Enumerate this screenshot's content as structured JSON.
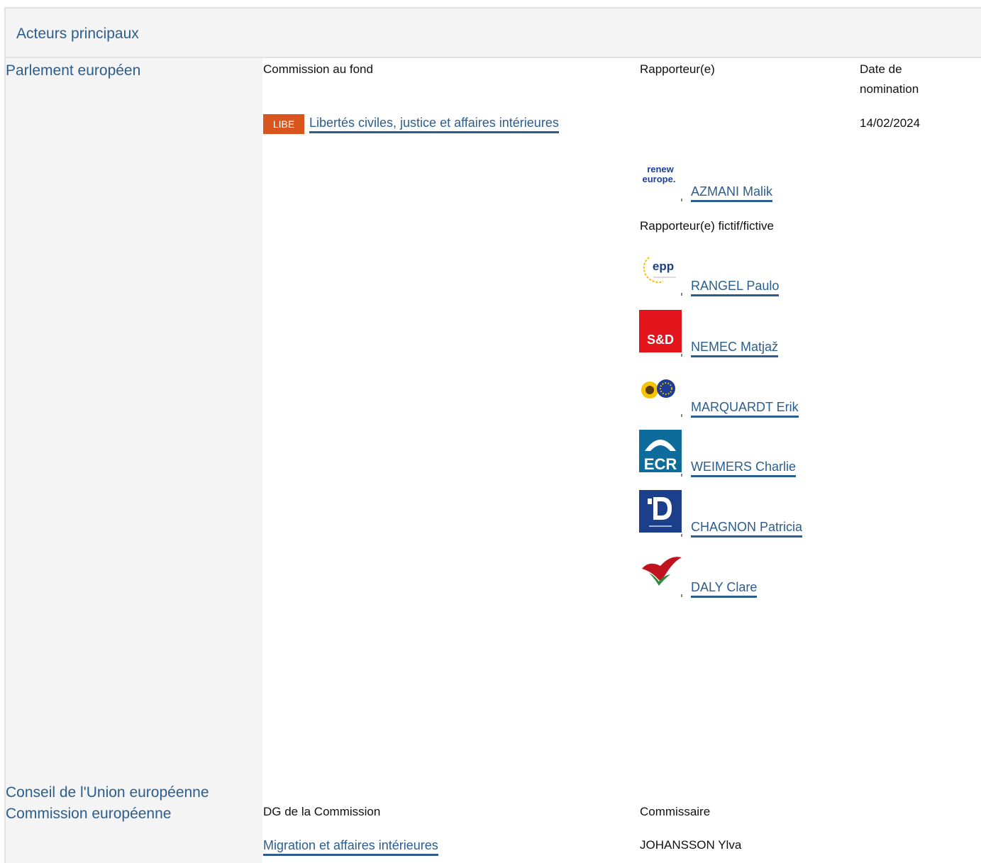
{
  "section": {
    "title": "Acteurs principaux"
  },
  "parliament": {
    "institution": "Parlement européen",
    "col_committee": "Commission au fond",
    "col_rapporteur": "Rapporteur(e)",
    "col_date": "Date de nomination",
    "committee_code": "LIBE",
    "committee_name": "Libertés civiles, justice et affaires intérieures",
    "date": "14/02/2024",
    "rapporteur": {
      "group": "Renew Europe",
      "logo_text_1": "renew",
      "logo_text_2": "europe.",
      "name": "AZMANI Malik"
    },
    "shadow_label": "Rapporteur(e) fictif/fictive",
    "shadows": [
      {
        "group": "EPP",
        "logo_text": "epp",
        "name": "RANGEL Paulo"
      },
      {
        "group": "S&D",
        "logo_text": "S&D",
        "name": "NEMEC Matjaž"
      },
      {
        "group": "Greens/EFA",
        "name": "MARQUARDT Erik"
      },
      {
        "group": "ECR",
        "logo_text": "ECR",
        "name": "WEIMERS Charlie"
      },
      {
        "group": "ID",
        "name": "CHAGNON Patricia"
      },
      {
        "group": "The Left",
        "name": "DALY Clare"
      }
    ]
  },
  "council": {
    "institution": "Conseil de l'Union européenne"
  },
  "commission": {
    "institution": "Commission européenne",
    "col_dg": "DG de la Commission",
    "col_commissioner": "Commissaire",
    "dg": "Migration et affaires intérieures",
    "commissioner": "JOHANSSON Ylva"
  },
  "colors": {
    "link": "#2b5d8f",
    "badge": "#d9541e",
    "header_bg": "#f4f4f4"
  }
}
